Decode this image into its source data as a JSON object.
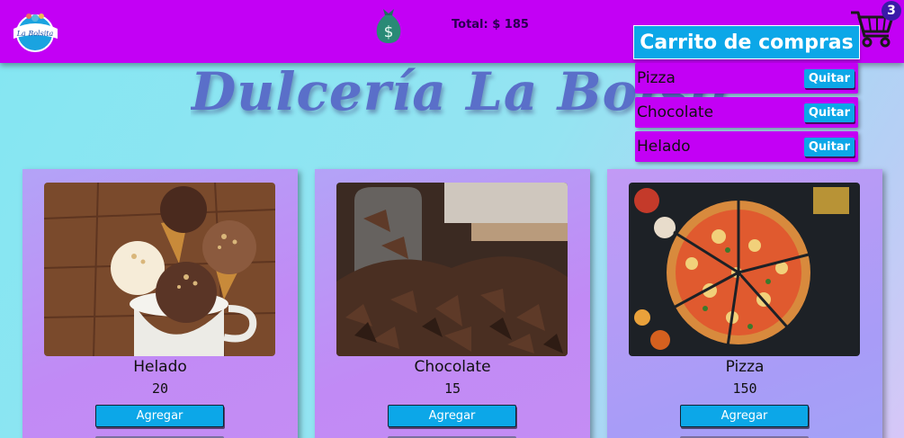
{
  "header": {
    "logo_text": "La Bolsita",
    "total_text": "Total: $ 185",
    "cart_count": "3"
  },
  "site_title": "Dulcería La Bolsita",
  "cart": {
    "title": "Carrito de compras",
    "remove_label": "Quitar",
    "items": [
      {
        "name": "Pizza"
      },
      {
        "name": "Chocolate"
      },
      {
        "name": "Helado"
      }
    ]
  },
  "products": [
    {
      "name": "Helado",
      "price": "20",
      "button": "Agregar"
    },
    {
      "name": "Chocolate",
      "price": "15",
      "button": "Agregar"
    },
    {
      "name": "Pizza",
      "price": "150",
      "button": "Agregar"
    }
  ],
  "colors": {
    "header": "#c300f5",
    "accent": "#0ca7e8",
    "title": "#5a6fc9"
  }
}
